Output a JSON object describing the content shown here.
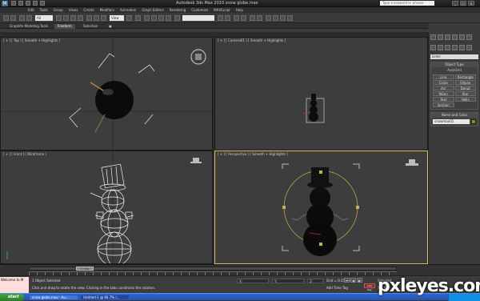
{
  "window": {
    "title": "Autodesk 3ds Max 2010    snow globe.max",
    "search_placeholder": "Type a keyword or phrase",
    "app_logo": "M"
  },
  "menu": [
    "Edit",
    "Tools",
    "Group",
    "Views",
    "Create",
    "Modifiers",
    "Animation",
    "Graph Editors",
    "Rendering",
    "Customize",
    "MAXScript",
    "Help"
  ],
  "toolbar": {
    "selection_filter": "All",
    "ref_coord": "View"
  },
  "ribbon": {
    "tabs": [
      "Graphite Modeling Tools",
      "Freeform",
      "Selection"
    ],
    "active_tab": "Freeform"
  },
  "viewports": {
    "top": "[ + ] [ Top ] [ Smooth + Highlights ]",
    "camera": "[ + ] [ Camera01 ] [ Smooth + Highlights ]",
    "front": "[ + ] [ Front ] [ Wireframe ]",
    "perspective": "[ + ] [ Perspective ] [ Smooth + Highlights ]"
  },
  "command_panel": {
    "category": "Lines",
    "object_type_title": "Object Type",
    "autogrid": "AutoGrid",
    "objects": [
      "Line",
      "Rectangle",
      "Circle",
      "Ellipse",
      "Arc",
      "Donut",
      "NGon",
      "Star",
      "Text",
      "Helix",
      "Section",
      ""
    ],
    "name_color_title": "Name and Color",
    "name_value": "snowman01",
    "swatch_color": "#888f2a"
  },
  "timeline": {
    "slider_label": "0 / 100"
  },
  "status": {
    "listener_text": "Welcome to M",
    "selected": "1 Object Selected",
    "prompt": "Click and drag to rotate the view.  Clicking in the tabs constrains the rotation.",
    "x": "X:",
    "y": "Y:",
    "z": "Z:",
    "grid": "Grid = 0.25mm",
    "autokey": "Auto Key",
    "setkey": "Set Key",
    "selected_label": "Selected",
    "add_time_tag": "Add Time Tag"
  },
  "taskbar": {
    "start": "start",
    "items": [
      {
        "label": "snow globe.max - Au...",
        "active": false
      },
      {
        "label": "Untitled-1 @ 66.7% (...",
        "active": true
      }
    ]
  },
  "watermark": "pxleyes.com"
}
